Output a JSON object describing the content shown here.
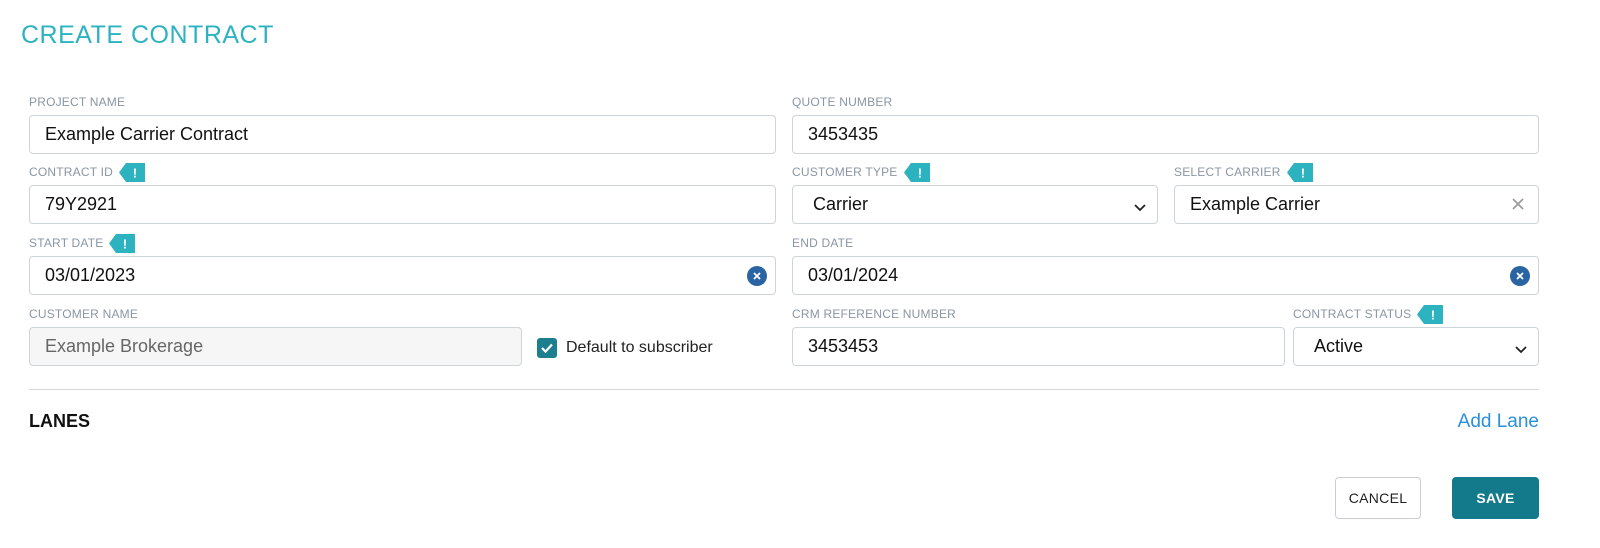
{
  "page": {
    "title": "CREATE CONTRACT"
  },
  "colors": {
    "accent": "#2db3c0",
    "primary_button": "#127a8a",
    "link": "#2b8fd9",
    "clear_icon": "#2a64a3"
  },
  "form": {
    "project_name": {
      "label": "PROJECT NAME",
      "value": "Example Carrier Contract"
    },
    "quote_number": {
      "label": "QUOTE NUMBER",
      "value": "3453435"
    },
    "contract_id": {
      "label": "CONTRACT ID",
      "value": "79Y2921",
      "badge": "!"
    },
    "customer_type": {
      "label": "CUSTOMER TYPE",
      "value": "Carrier",
      "badge": "!"
    },
    "select_carrier": {
      "label": "SELECT CARRIER",
      "value": "Example Carrier",
      "badge": "!"
    },
    "start_date": {
      "label": "START DATE",
      "value": "03/01/2023",
      "badge": "!"
    },
    "end_date": {
      "label": "END DATE",
      "value": "03/01/2024"
    },
    "customer_name": {
      "label": "CUSTOMER NAME",
      "value": "Example Brokerage"
    },
    "default_to_subscriber": {
      "label": "Default to subscriber",
      "checked": true
    },
    "crm_reference_number": {
      "label": "CRM REFERENCE NUMBER",
      "value": "3453453"
    },
    "contract_status": {
      "label": "CONTRACT STATUS",
      "value": "Active",
      "badge": "!"
    }
  },
  "lanes": {
    "title": "LANES",
    "add_label": "Add Lane"
  },
  "actions": {
    "cancel_label": "CANCEL",
    "save_label": "SAVE"
  }
}
